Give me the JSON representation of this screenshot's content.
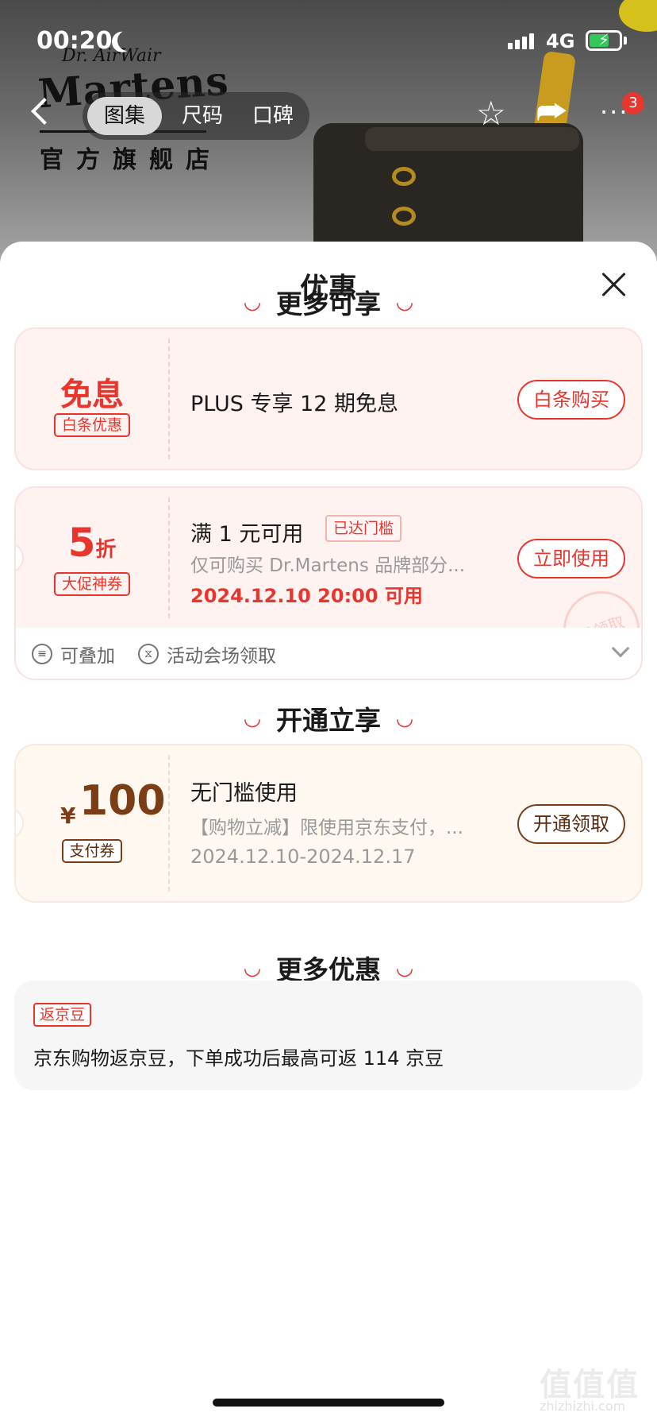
{
  "status": {
    "time": "00:20",
    "network": "4G"
  },
  "brand": {
    "logo_top": "Dr. AirWair",
    "logo_name": "Martens",
    "store_label": "官方旗舰店"
  },
  "nav": {
    "tabs": [
      {
        "label": "图集",
        "active": true
      },
      {
        "label": "尺码",
        "active": false
      },
      {
        "label": "口碑",
        "active": false
      }
    ],
    "more_badge": "3"
  },
  "sheet": {
    "title": "优惠"
  },
  "sections": {
    "more_available": "更多可享",
    "open_to_enjoy": "开通立享",
    "more_offers": "更多优惠"
  },
  "coupons": {
    "interest_free": {
      "big": "免息",
      "tag": "白条优惠",
      "main": "PLUS 专享 12 期免息",
      "button": "白条购买"
    },
    "discount": {
      "big_num": "5",
      "big_unit": "折",
      "tag": "大促神券",
      "main": "满 1 元可用",
      "reached": "已达门槛",
      "sub": "仅可购买 Dr.Martens 品牌部分...",
      "date": "2024.12.10 20:00 可用",
      "button": "立即使用",
      "stamp": "已领取",
      "footer_stackable": "可叠加",
      "footer_source": "活动会场领取"
    },
    "payment": {
      "currency": "¥",
      "amount": "100",
      "tag": "支付券",
      "main": "无门槛使用",
      "sub": "【购物立减】限使用京东支付，...",
      "date": "2024.12.10-2024.12.17",
      "button": "开通领取"
    }
  },
  "bean": {
    "tag": "返京豆",
    "text": "京东购物返京豆，下单成功后最高可返 114 京豆"
  },
  "watermark": {
    "main": "值值值",
    "sub": "zhizhizhi.com"
  },
  "colors": {
    "accent": "#e8362e",
    "brown": "#7a3d16",
    "pink_bg": "#fff3f2",
    "cream_bg": "#fff8f1"
  }
}
